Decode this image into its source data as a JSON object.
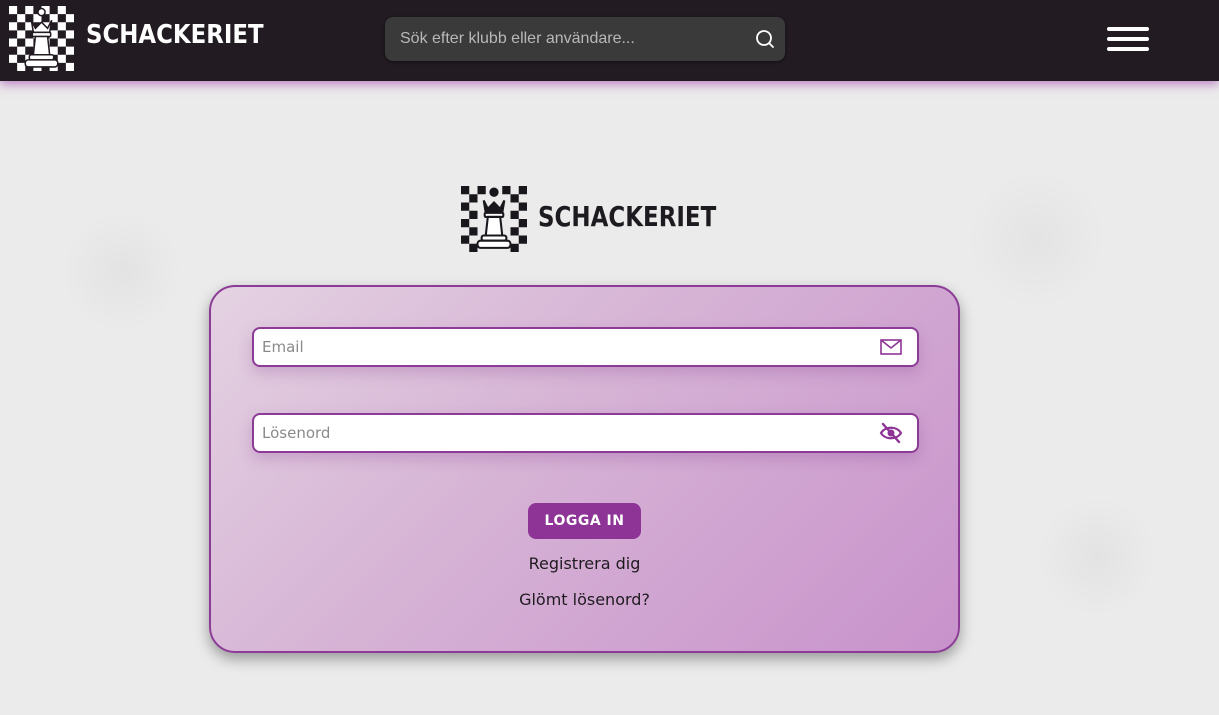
{
  "header": {
    "brand": "SCHACKERIET",
    "search": {
      "placeholder": "Sök efter klubb eller användare..."
    },
    "icons": {
      "logo": "chess-queen-checker-logo-icon",
      "search": "search-icon",
      "menu": "hamburger-menu-icon"
    }
  },
  "main": {
    "brand": "SCHACKERIET",
    "login": {
      "email_placeholder": "Email",
      "password_placeholder": "Lösenord",
      "submit_label": "LOGGA IN",
      "register_label": "Registrera dig",
      "forgot_label": "Glömt lösenord?",
      "icons": {
        "email": "envelope-icon",
        "password": "eye-off-icon"
      }
    }
  },
  "colors": {
    "header_bg": "#221b22",
    "accent": "#8e3496",
    "card_border": "#8c3c96",
    "page_bg": "#ececec"
  }
}
